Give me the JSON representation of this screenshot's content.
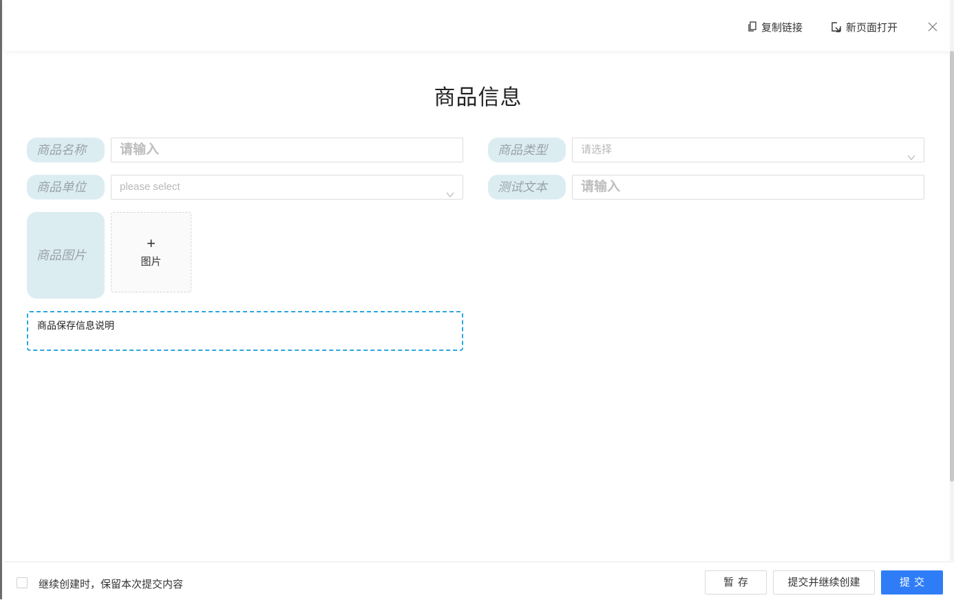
{
  "topbar": {
    "copy_link": "复制链接",
    "open_new_page": "新页面打开"
  },
  "page": {
    "title": "商品信息"
  },
  "form": {
    "product_name": {
      "label": "商品名称",
      "placeholder": "请输入"
    },
    "product_type": {
      "label": "商品类型",
      "placeholder": "请选择"
    },
    "product_unit": {
      "label": "商品单位",
      "placeholder": "please select"
    },
    "test_text": {
      "label": "测试文本",
      "placeholder": "请输入"
    },
    "product_image": {
      "label": "商品图片",
      "upload_plus": "+",
      "upload_text": "图片"
    },
    "note": "商品保存信息说明"
  },
  "footer": {
    "keep_content_label": "继续创建时，保留本次提交内容",
    "save_draft": "暂存",
    "submit_continue": "提交并继续创建",
    "submit": "提交"
  },
  "colors": {
    "label_bg": "#dcedf2",
    "primary": "#2f7df6",
    "note_border": "#2aa5e0"
  }
}
